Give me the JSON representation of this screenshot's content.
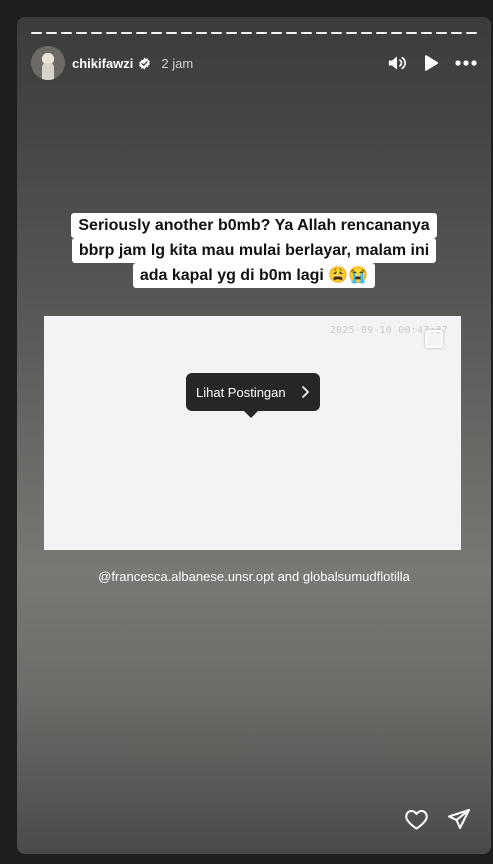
{
  "story": {
    "progress_segments": 30,
    "username": "chikifawzi",
    "time_ago": "2 jam",
    "caption_lines": [
      "Seriously another b0mb? Ya Allah rencananya",
      "bbrp jam lg kita mau mulai berlayar, malam ini",
      "ada kapal yg di b0m lagi 😩😭"
    ],
    "post_timestamp": "2025-09-10 00:47:37",
    "view_post_label": "Lihat Postingan",
    "mention_1": "@francesca.albanese.unsr.opt",
    "mention_joiner": "and",
    "mention_2": "globalsumudflotilla"
  },
  "icons": {
    "verified": "verified-badge-icon",
    "sound": "speaker-icon",
    "play": "play-icon",
    "more": "more-dots-icon",
    "like": "heart-icon",
    "share": "paper-plane-icon",
    "chevron": "chevron-right-icon",
    "multi": "multi-post-icon"
  },
  "colors": {
    "page_bg": "#1e1e1e",
    "tooltip_bg": "#262626",
    "caption_bg": "#ffffff"
  }
}
